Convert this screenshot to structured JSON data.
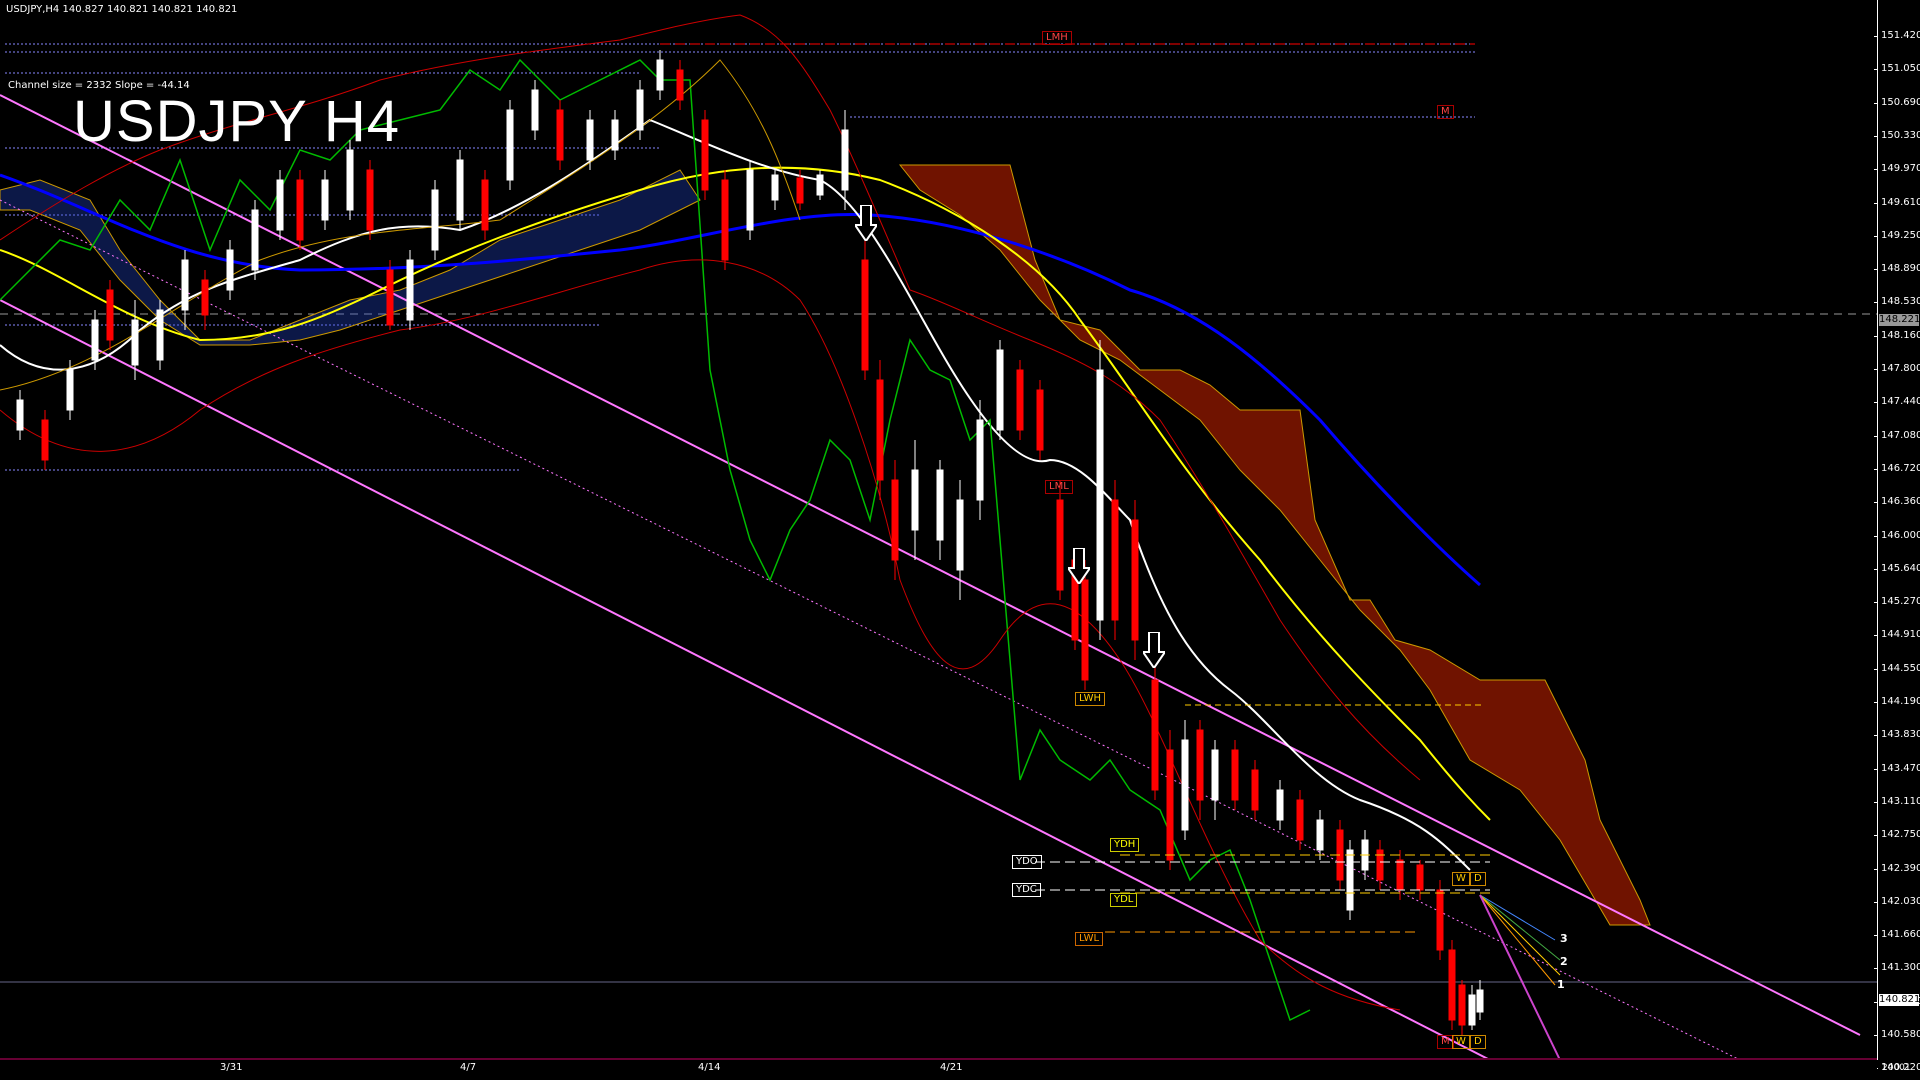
{
  "chart": {
    "header": "USDJPY,H4  140.827 140.821 140.821 140.821",
    "channel_info": "Channel size = 2332 Slope = -44.14",
    "big_title": "USDJPY H4",
    "current_price": "140.821",
    "reference_price": "148.221",
    "corner": "20001"
  },
  "price_axis": {
    "ticks": [
      "151.420",
      "151.050",
      "150.690",
      "150.330",
      "149.970",
      "149.610",
      "149.250",
      "148.890",
      "148.530",
      "148.160",
      "147.800",
      "147.440",
      "147.080",
      "146.720",
      "146.360",
      "146.000",
      "145.640",
      "145.270",
      "144.910",
      "144.550",
      "144.190",
      "143.830",
      "143.470",
      "143.110",
      "142.750",
      "142.390",
      "142.030",
      "141.660",
      "141.300",
      "140.940",
      "140.580",
      "140.220"
    ]
  },
  "time_axis": {
    "labels": [
      "3/31",
      "4/7",
      "4/14",
      "4/21"
    ]
  },
  "level_tags": {
    "lmh": "LMH",
    "m_top": "M",
    "lml": "LML",
    "lwh": "LWH",
    "ydh": "YDH",
    "ydo": "YDO",
    "ydc": "YDC",
    "ydl": "YDL",
    "lwl": "LWL",
    "w_right": "W",
    "d_right": "D",
    "m_bottom": "M",
    "w_bottom": "W",
    "d_bottom": "D"
  },
  "wave_labels": [
    "3",
    "2",
    "1"
  ],
  "colors": {
    "background": "#000000",
    "bull_candle": "#ffffff",
    "bear_candle": "#ff0000",
    "channel": "#ff66ff",
    "kumo": "#ff3300",
    "kijun": "#ffff00",
    "sma_long": "#0000ff",
    "sma_fast": "#ffffff",
    "chikou": "#00cc00",
    "bollinger": "#cc0000"
  }
}
